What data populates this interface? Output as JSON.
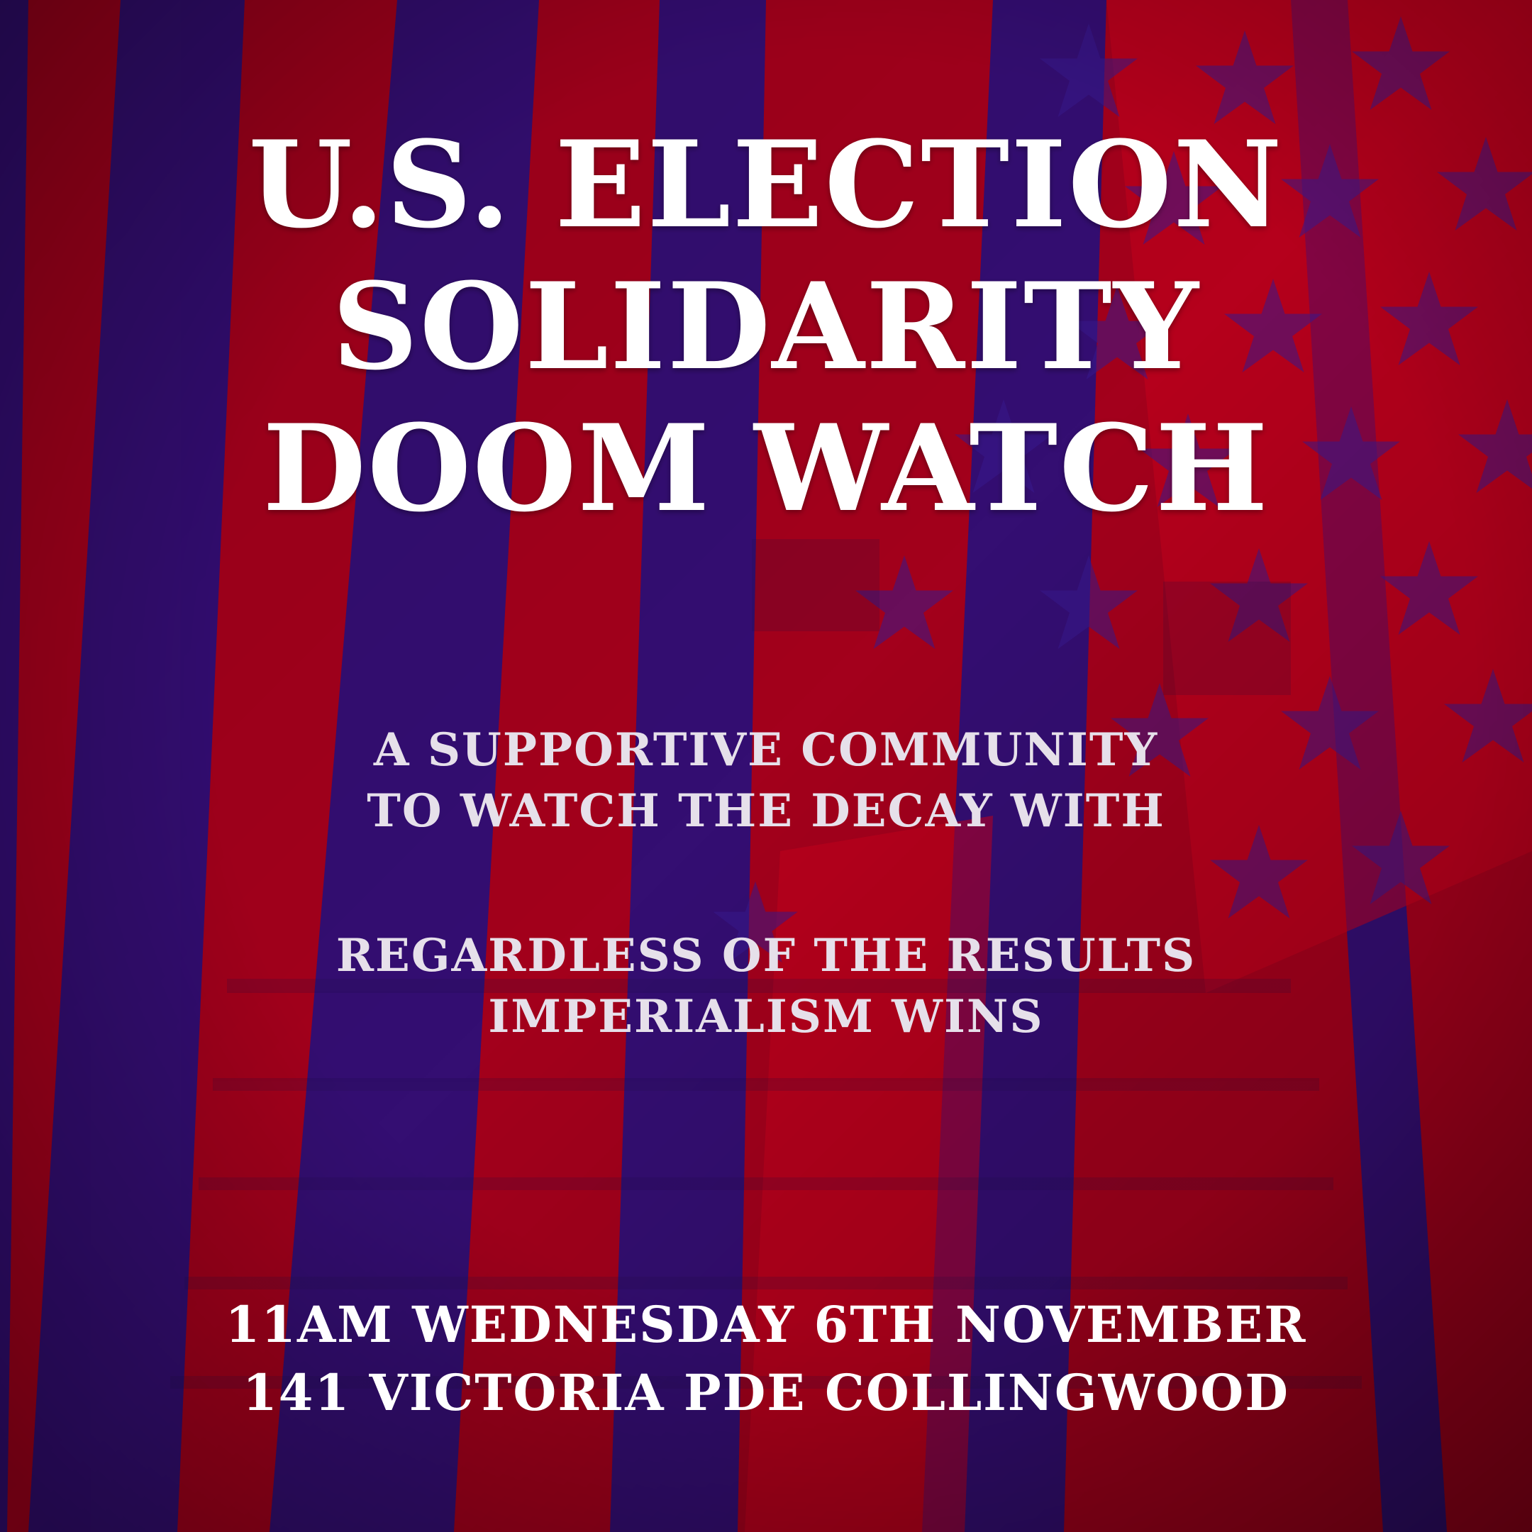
{
  "poster": {
    "title": [
      "U.S. ELECTION",
      "SOLIDARITY",
      "DOOM WATCH"
    ],
    "tagline_1": [
      "A SUPPORTIVE COMMUNITY",
      "TO WATCH THE DECAY WITH"
    ],
    "tagline_2": [
      "REGARDLESS OF THE RESULTS",
      "IMPERIALISM WINS"
    ],
    "details": {
      "time_date": "11AM WEDNESDAY 6TH NOVEMBER",
      "address": "141 VICTORIA PDE COLLINGWOOD"
    }
  },
  "colors": {
    "stripe_red": "#a3001c",
    "stripe_blue": "#2a0f7a",
    "title_text": "#ffffff",
    "body_text": "#e6e0ea"
  },
  "icons": [
    "flag-stripes-background",
    "star-pattern"
  ]
}
